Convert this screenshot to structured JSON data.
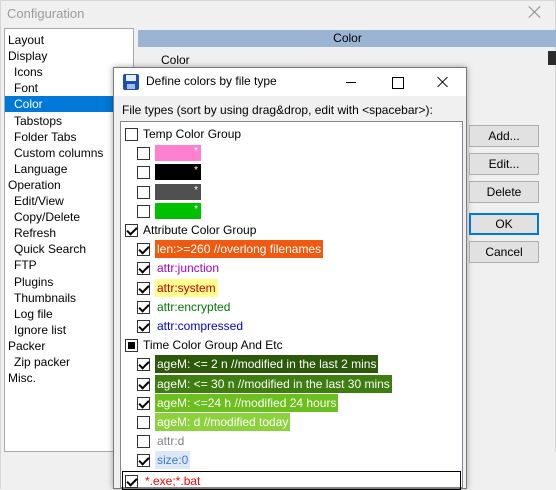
{
  "config_window": {
    "title": "Configuration",
    "header": "Color",
    "subheader": "Color",
    "tree": [
      {
        "label": "Layout",
        "indent": 0
      },
      {
        "label": "Display",
        "indent": 0
      },
      {
        "label": "Icons",
        "indent": 1
      },
      {
        "label": "Font",
        "indent": 1
      },
      {
        "label": "Color",
        "indent": 1,
        "selected": true
      },
      {
        "label": "Tabstops",
        "indent": 1
      },
      {
        "label": "Folder Tabs",
        "indent": 1
      },
      {
        "label": "Custom columns",
        "indent": 1
      },
      {
        "label": "Language",
        "indent": 1
      },
      {
        "label": "Operation",
        "indent": 0
      },
      {
        "label": "Edit/View",
        "indent": 1
      },
      {
        "label": "Copy/Delete",
        "indent": 1
      },
      {
        "label": "Refresh",
        "indent": 1
      },
      {
        "label": "Quick Search",
        "indent": 1
      },
      {
        "label": "FTP",
        "indent": 1
      },
      {
        "label": "Plugins",
        "indent": 1
      },
      {
        "label": "Thumbnails",
        "indent": 1
      },
      {
        "label": "Log file",
        "indent": 1
      },
      {
        "label": "Ignore list",
        "indent": 1
      },
      {
        "label": "Packer",
        "indent": 0
      },
      {
        "label": "Zip packer",
        "indent": 1
      },
      {
        "label": "Misc.",
        "indent": 0
      }
    ]
  },
  "dialog": {
    "title": "Define colors by file type",
    "list_label": "File types (sort by using drag&drop, edit with <spacebar>):",
    "buttons": {
      "add": "Add...",
      "edit": "Edit...",
      "delete": "Delete",
      "ok": "OK",
      "cancel": "Cancel"
    },
    "rows": [
      {
        "kind": "group",
        "label": "Temp Color Group",
        "state": "unchecked"
      },
      {
        "kind": "swatch",
        "label": "*",
        "state": "unchecked",
        "bg": "#ff80d0",
        "fg": "#ffffff"
      },
      {
        "kind": "swatch",
        "label": "*",
        "state": "unchecked",
        "bg": "#000000",
        "fg": "#ffffff"
      },
      {
        "kind": "swatch",
        "label": "*",
        "state": "unchecked",
        "bg": "#505050",
        "fg": "#ffffff"
      },
      {
        "kind": "swatch",
        "label": "*",
        "state": "unchecked",
        "bg": "#00c000",
        "fg": "#ffffff"
      },
      {
        "kind": "group",
        "label": "Attribute Color Group",
        "state": "checked"
      },
      {
        "kind": "item",
        "label": "len:>=260 //overlong filenames",
        "state": "checked",
        "bg": "#f05a10",
        "fg": "#ffffff"
      },
      {
        "kind": "item",
        "label": "attr:junction",
        "state": "checked",
        "bg": "",
        "fg": "#a000c8"
      },
      {
        "kind": "item",
        "label": "attr:system",
        "state": "checked",
        "bg": "#ffff90",
        "fg": "#c00000"
      },
      {
        "kind": "item",
        "label": "attr:encrypted",
        "state": "checked",
        "bg": "",
        "fg": "#007800"
      },
      {
        "kind": "item",
        "label": "attr:compressed",
        "state": "checked",
        "bg": "",
        "fg": "#0000c8"
      },
      {
        "kind": "group",
        "label": "Time Color Group And Etc",
        "state": "mixed"
      },
      {
        "kind": "item",
        "label": "ageM: <= 2 n //modified in the last 2 mins",
        "state": "checked",
        "bg": "#2d5a0a",
        "fg": "#ffffff"
      },
      {
        "kind": "item",
        "label": "ageM: <= 30 n //modified in the last 30 mins",
        "state": "checked",
        "bg": "#3e7d10",
        "fg": "#ffffff"
      },
      {
        "kind": "item",
        "label": "ageM: <=24 h //modified 24 hours",
        "state": "checked",
        "bg": "#6cc01e",
        "fg": "#ffffff"
      },
      {
        "kind": "item",
        "label": "ageM: d //modified today",
        "state": "unchecked",
        "bg": "#8cd23c",
        "fg": "#ffffff"
      },
      {
        "kind": "item",
        "label": "attr:d",
        "state": "unchecked",
        "bg": "",
        "fg": "#808080"
      },
      {
        "kind": "item",
        "label": "size:0",
        "state": "checked",
        "bg": "#dce8f8",
        "fg": "#3c78c8"
      },
      {
        "kind": "item",
        "label": "*.exe;*.bat",
        "state": "checked",
        "bg": "",
        "fg": "#ff0000",
        "focused": true
      }
    ]
  }
}
